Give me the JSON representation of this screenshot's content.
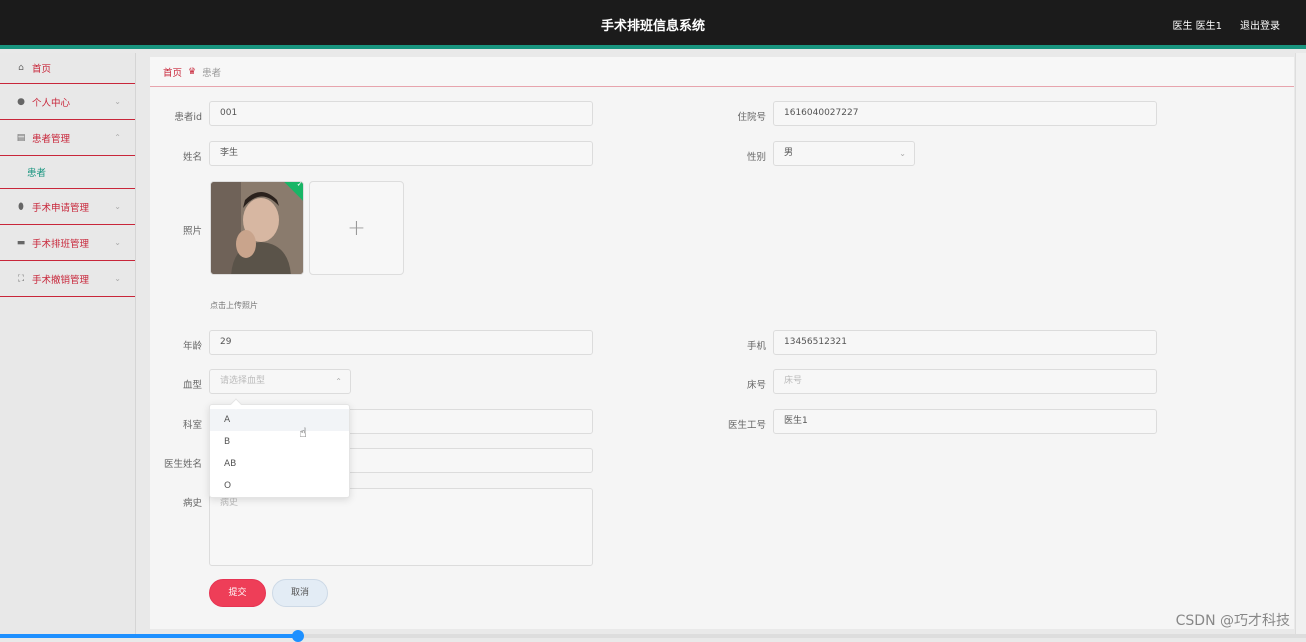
{
  "header": {
    "title": "手术排班信息系统",
    "user": "医生 医生1",
    "logout": "退出登录"
  },
  "sidebar": {
    "items": [
      {
        "label": "首页",
        "icon": "home-icon"
      },
      {
        "label": "个人中心",
        "icon": "user-icon"
      },
      {
        "label": "患者管理",
        "icon": "chart-icon"
      },
      {
        "label": "手术申请管理",
        "icon": "location-icon"
      },
      {
        "label": "手术排班管理",
        "icon": "message-icon"
      },
      {
        "label": "手术撤销管理",
        "icon": "fullscreen-icon"
      }
    ],
    "sub_items": [
      {
        "label": "患者"
      }
    ]
  },
  "breadcrumb": {
    "home": "首页",
    "current": "患者"
  },
  "form": {
    "patient_id_label": "患者id",
    "patient_id_value": "001",
    "hospital_no_label": "住院号",
    "hospital_no_value": "1616040027227",
    "name_label": "姓名",
    "name_value": "李生",
    "gender_label": "性别",
    "gender_value": "男",
    "photo_label": "照片",
    "photo_hint": "点击上传照片",
    "age_label": "年龄",
    "age_value": "29",
    "phone_label": "手机",
    "phone_value": "13456512321",
    "blood_type_label": "血型",
    "blood_type_placeholder": "请选择血型",
    "bed_label": "床号",
    "bed_placeholder": "床号",
    "department_label": "科室",
    "doctor_id_label": "医生工号",
    "doctor_id_value": "医生1",
    "doctor_name_label": "医生姓名",
    "history_label": "病史",
    "history_placeholder": "病史",
    "submit": "提交",
    "cancel": "取消"
  },
  "blood_type_options": [
    "A",
    "B",
    "AB",
    "O"
  ],
  "watermark": "CSDN @巧才科技",
  "colors": {
    "accent": "#c8263a",
    "teal": "#18957f",
    "submit": "#ee3e58"
  }
}
